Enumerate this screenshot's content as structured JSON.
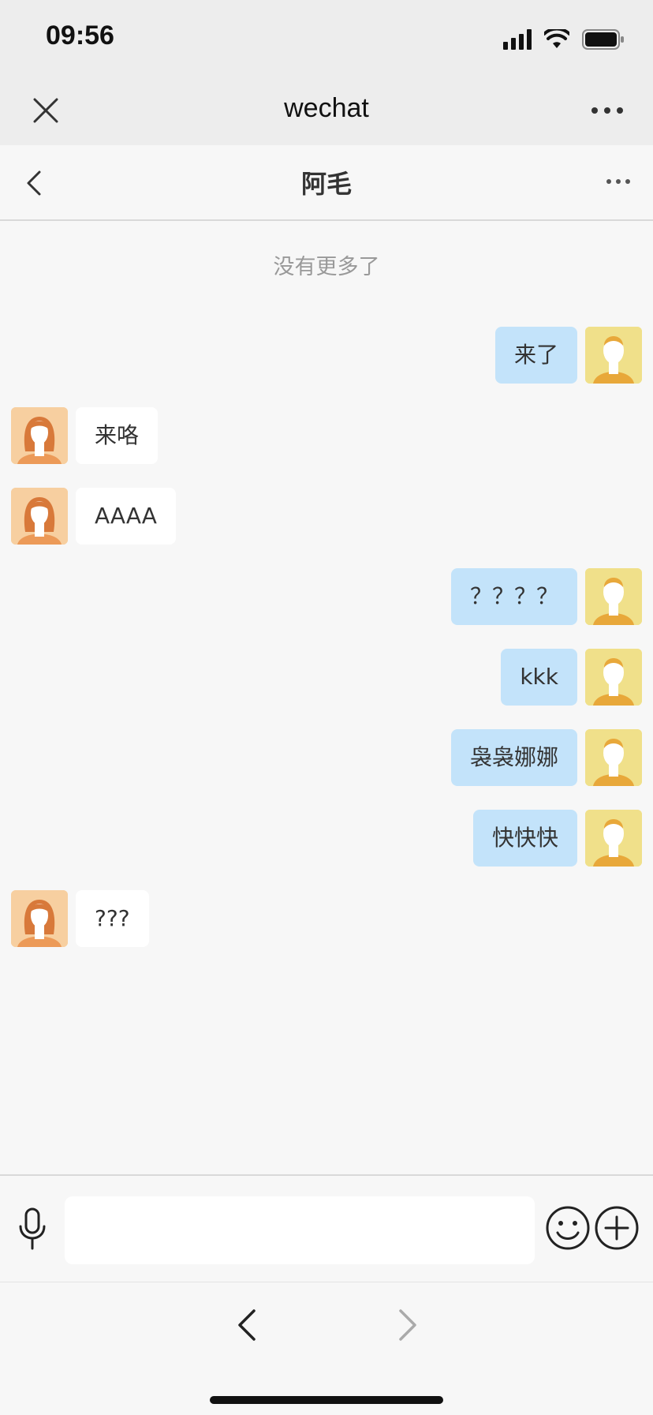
{
  "status_bar": {
    "time": "09:56",
    "icons": [
      "cellular-signal-icon",
      "wifi-icon",
      "battery-icon"
    ]
  },
  "wechat_bar": {
    "title": "wechat",
    "close_icon": "close-icon",
    "more_icon": "more-dots-icon"
  },
  "chat_header": {
    "title": "阿毛",
    "back_icon": "chevron-left-icon",
    "more_icon": "more-dots-icon"
  },
  "chat": {
    "no_more_text": "没有更多了",
    "messages": [
      {
        "side": "right",
        "text": "来了",
        "avatar": "male-avatar"
      },
      {
        "side": "left",
        "text": "来咯",
        "avatar": "female-avatar"
      },
      {
        "side": "left",
        "text": "AAAA",
        "avatar": "female-avatar"
      },
      {
        "side": "right",
        "text": "？？？？",
        "avatar": "male-avatar"
      },
      {
        "side": "right",
        "text": "kkk",
        "avatar": "male-avatar"
      },
      {
        "side": "right",
        "text": "袅袅娜娜",
        "avatar": "male-avatar"
      },
      {
        "side": "right",
        "text": "快快快",
        "avatar": "male-avatar"
      },
      {
        "side": "left",
        "text": "???",
        "avatar": "female-avatar"
      }
    ]
  },
  "input_bar": {
    "value": "",
    "placeholder": "",
    "icons": [
      "microphone-icon",
      "emoji-icon",
      "plus-icon"
    ]
  },
  "browser_nav": {
    "icons": [
      "back-arrow-icon",
      "forward-arrow-icon"
    ]
  },
  "colors": {
    "sent_bubble": "#c3e3fa",
    "received_bubble": "#ffffff",
    "background": "#f7f7f7"
  }
}
